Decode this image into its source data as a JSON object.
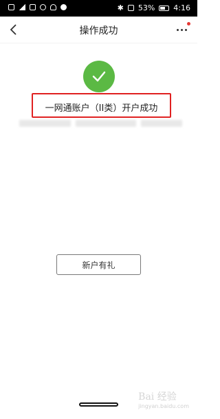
{
  "status_bar": {
    "battery": "53%",
    "time": "4:16"
  },
  "nav": {
    "title": "操作成功"
  },
  "result": {
    "message": "一网通账户（II类）开户成功"
  },
  "actions": {
    "gift_label": "新户有礼"
  },
  "watermark": {
    "text": "Bai 经验",
    "sub": "jingyan.baidu.com"
  },
  "colors": {
    "success": "#5bb944",
    "highlight": "#e02020",
    "badge": "#e53935"
  }
}
